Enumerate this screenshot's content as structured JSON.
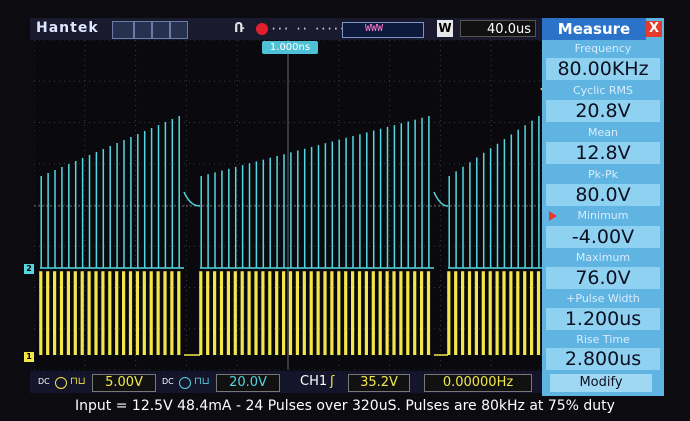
{
  "brand": "Hantek",
  "run_label": "Ռ",
  "memory_markers": "··· ·· ·····",
  "buffer_text": "WWW",
  "timebase_prefix": "W",
  "timebase": "40.0us",
  "trigger_position": "1.000ns",
  "channel_markers": {
    "ch1": "1",
    "ch2": "2"
  },
  "measure": {
    "title": "Measure",
    "close": "X",
    "items": [
      {
        "label": "Frequency",
        "value": "80.00KHz"
      },
      {
        "label": "Cyclic RMS",
        "value": "20.8V"
      },
      {
        "label": "Mean",
        "value": "12.8V"
      },
      {
        "label": "Pk-Pk",
        "value": "80.0V"
      },
      {
        "label": "Minimum",
        "value": "-4.00V"
      },
      {
        "label": "Maximum",
        "value": "76.0V"
      },
      {
        "label": "+Pulse Width",
        "value": "1.200us"
      },
      {
        "label": "Rise Time",
        "value": "2.800us"
      }
    ],
    "modify": "Modify"
  },
  "status": {
    "ch1_scale": "5.00V",
    "ch2_scale": "20.0V",
    "trigger_source": "CH1",
    "trigger_level": "35.2V",
    "trigger_freq": "0.00000Hz",
    "coupling_ch1": "DC",
    "coupling_ch2": "DC"
  },
  "caption": "Input = 12.5V 48.4mA - 24 Pulses over 320uS. Pulses are 80kHz at 75% duty",
  "colors": {
    "ch1": "#f2e74a",
    "ch2": "#55d6e0",
    "grid": "#3a3a48",
    "panel": "#5fb4e2"
  },
  "waveform": {
    "pulse_count_per_burst": 24,
    "bursts": 2,
    "pulse_frequency_khz": 80,
    "duty_percent": 75
  }
}
